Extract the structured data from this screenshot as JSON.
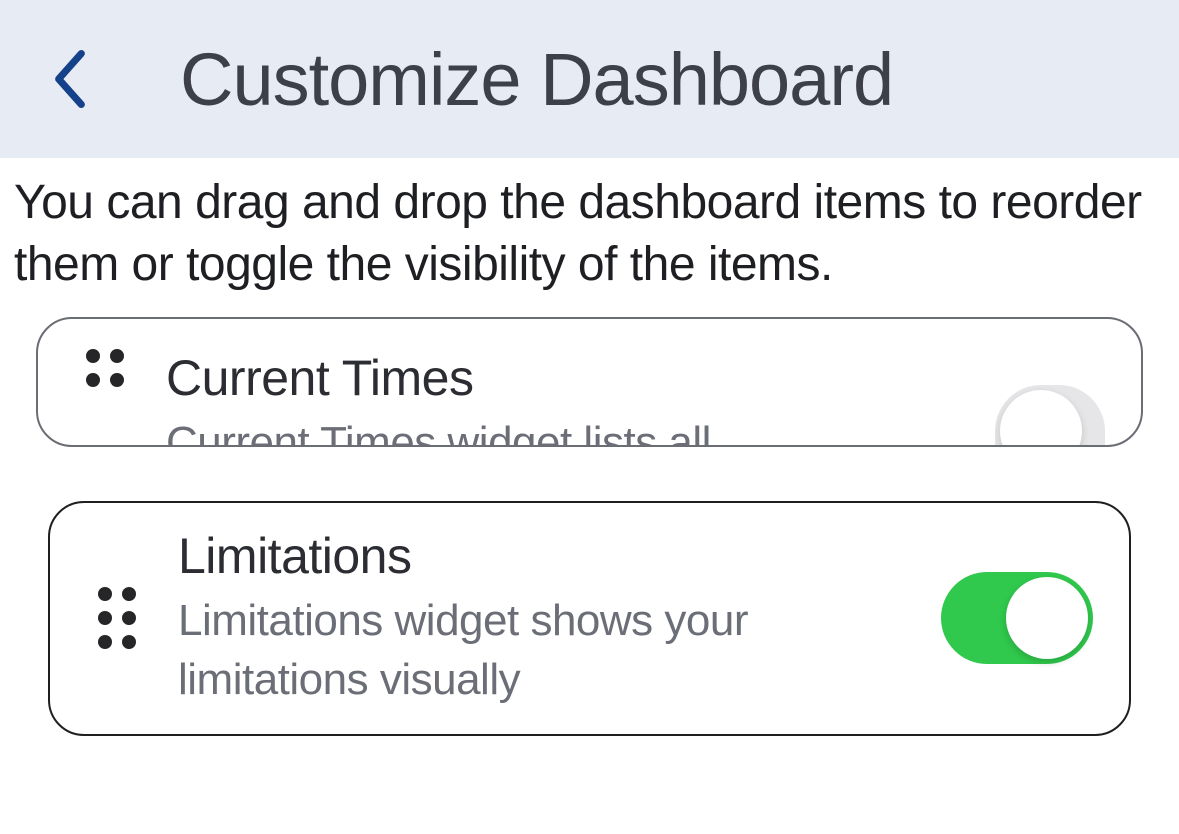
{
  "header": {
    "title": "Customize Dashboard"
  },
  "instructions": "You can drag and drop the dashboard items to reorder them or toggle the visibility of the items.",
  "items": [
    {
      "title": "Current Times",
      "description": "Current Times widget lists all",
      "enabled": false
    },
    {
      "title": "Limitations",
      "description": "Limitations widget shows your limitations visually",
      "enabled": true
    }
  ]
}
